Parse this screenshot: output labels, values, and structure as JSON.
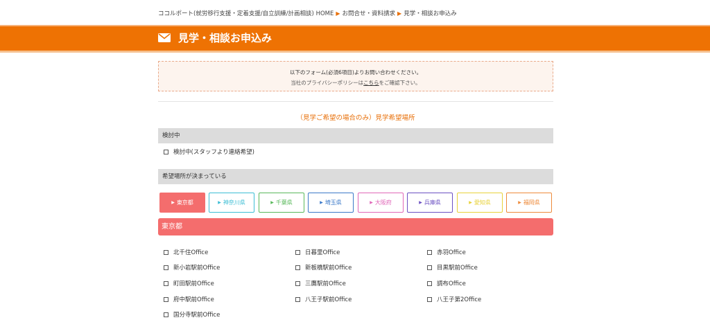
{
  "breadcrumb": {
    "home": "ココルポート(就労移行支援・定着支援/自立訓練/計画相談) HOME",
    "inquiry": "お問合せ・資料請求",
    "current": "見学・相談お申込み"
  },
  "banner": {
    "title": "見学・相談お申込み",
    "icon": "mail-icon"
  },
  "notice": {
    "line1": "以下のフォーム(必須6項目)よりお問い合わせください。",
    "line2_prefix": "当社のプライバシーポリシーは",
    "line2_link": "こちら",
    "line2_suffix": "をご確認下さい。"
  },
  "section_title": "（見学ご希望の場合のみ）見学希望場所",
  "considering": {
    "header": "検討中",
    "option": "検討中(スタッフより連絡希望)"
  },
  "decided": {
    "header": "希望場所が決まっている"
  },
  "tabs": [
    {
      "label": "東京都",
      "color": "#f46d6d",
      "active": true
    },
    {
      "label": "神奈川県",
      "color": "#3bbdd4",
      "active": false
    },
    {
      "label": "千葉県",
      "color": "#58b85a",
      "active": false
    },
    {
      "label": "埼玉県",
      "color": "#3a78c8",
      "active": false
    },
    {
      "label": "大阪府",
      "color": "#e066b8",
      "active": false
    },
    {
      "label": "兵庫県",
      "color": "#6a4fc2",
      "active": false
    },
    {
      "label": "愛知県",
      "color": "#e8d23a",
      "active": false
    },
    {
      "label": "福岡県",
      "color": "#ee8a3a",
      "active": false
    }
  ],
  "region": {
    "title": "東京都"
  },
  "offices": [
    "北千住Office",
    "日暮里Office",
    "赤羽Office",
    "新小岩駅前Office",
    "新板橋駅前Office",
    "目黒駅前Office",
    "町田駅前Office",
    "三鷹駅前Office",
    "調布Office",
    "府中駅前Office",
    "八王子駅前Office",
    "八王子第2Office",
    "国分寺駅前Office"
  ],
  "colors": {
    "brand": "#ee7203",
    "accent_text": "#e8700a",
    "region": "#f46d6d"
  }
}
